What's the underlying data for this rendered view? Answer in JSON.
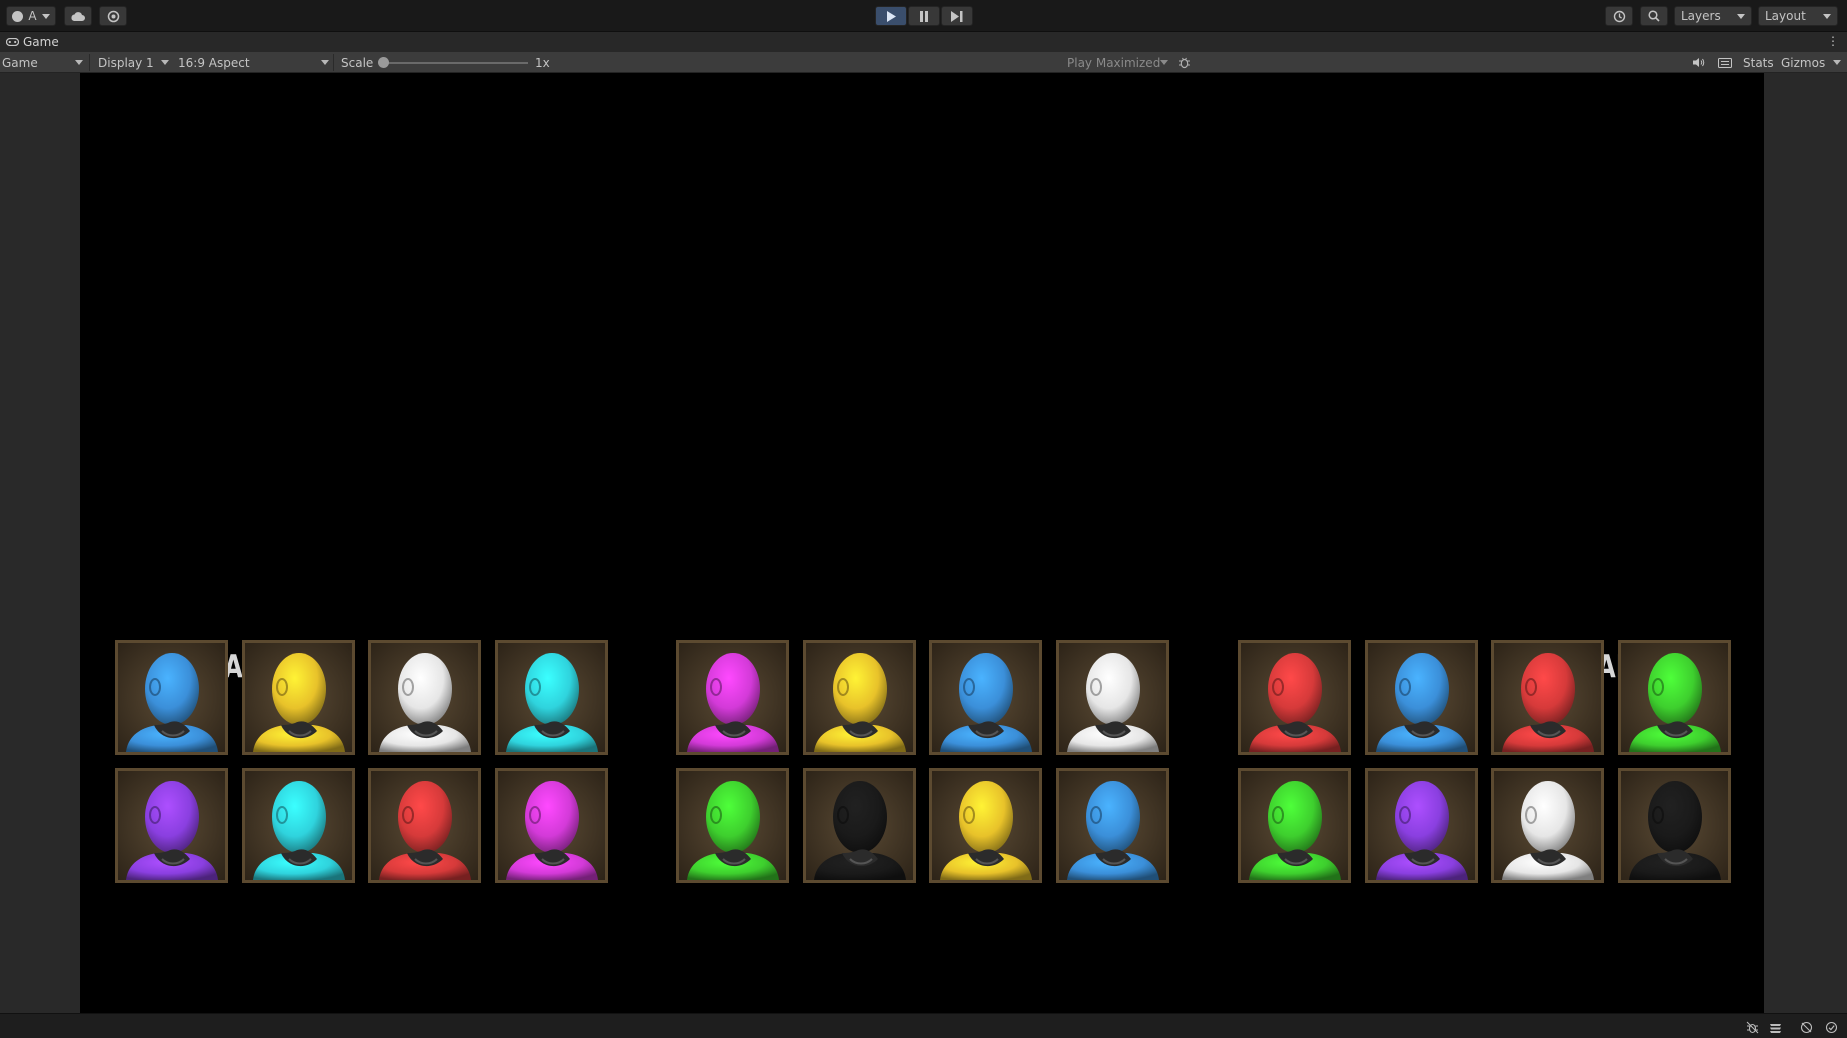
{
  "toolbar": {
    "account_label": "A",
    "layers_label": "Layers",
    "layout_label": "Layout"
  },
  "tab": {
    "title": "Game"
  },
  "gamebar": {
    "mode": "Game",
    "display": "Display 1",
    "aspect": "16:9 Aspect",
    "scale_label": "Scale",
    "scale_value": "1x",
    "play_mode": "Play Maximized",
    "stats": "Stats",
    "gizmos": "Gizmos"
  },
  "game": {
    "left_prompt": "PRESS ANY KEY",
    "right_prompt": "PRESS ANY KEY",
    "groups": [
      {
        "top": [
          "#3b8fd9",
          "#e8c22a",
          "#e6e6e6",
          "#2fd3dd"
        ],
        "bottom": [
          "#8a3fe0",
          "#2fd3dd",
          "#d63a3a",
          "#d33ad8"
        ]
      },
      {
        "top": [
          "#d33ad8",
          "#e8c22a",
          "#3b8fd9",
          "#e6e6e6"
        ],
        "bottom": [
          "#3ecf2e",
          "#1a1a1a",
          "#e8c22a",
          "#3b8fd9"
        ]
      },
      {
        "top": [
          "#d63a3a",
          "#3b8fd9",
          "#d63a3a",
          "#3ecf2e"
        ],
        "bottom": [
          "#3ecf2e",
          "#8a3fe0",
          "#e6e6e6",
          "#1a1a1a"
        ]
      }
    ]
  }
}
